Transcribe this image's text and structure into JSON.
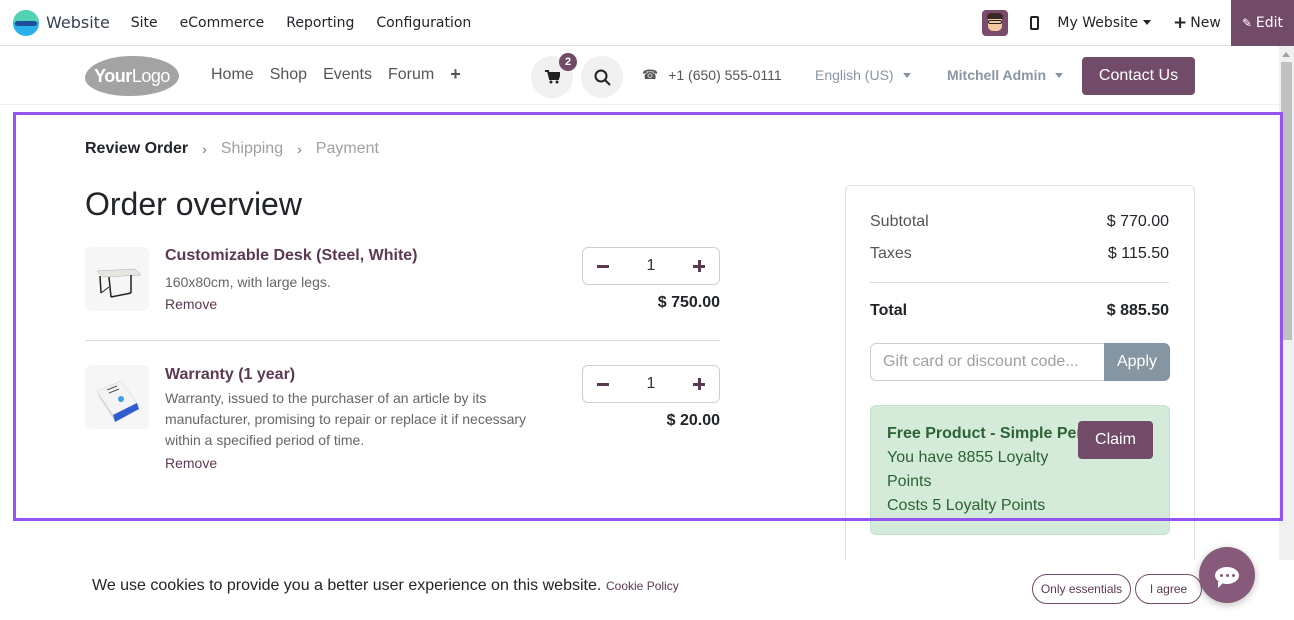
{
  "topbar": {
    "app_name": "Website",
    "menu": [
      "Site",
      "eCommerce",
      "Reporting",
      "Configuration"
    ],
    "website_selector": "My Website",
    "new_label": "New",
    "edit_label": "Edit"
  },
  "header": {
    "logo_bold": "Your",
    "logo_light": "Logo",
    "nav": [
      "Home",
      "Shop",
      "Events",
      "Forum"
    ],
    "add_icon": "+",
    "cart_count": "2",
    "phone": "+1 (650) 555-0111",
    "language": "English (US)",
    "user": "Mitchell Admin",
    "contact_label": "Contact Us"
  },
  "steps": {
    "active": "Review Order",
    "step2": "Shipping",
    "step3": "Payment"
  },
  "page_title": "Order overview",
  "items": [
    {
      "name": "Customizable Desk (Steel, White)",
      "description": "160x80cm, with large legs.",
      "remove_label": "Remove",
      "quantity": "1",
      "price": "$ 750.00"
    },
    {
      "name": "Warranty (1 year)",
      "description": "Warranty, issued to the purchaser of an article by its manufacturer, promising to repair or replace it if necessary within a specified period of time.",
      "remove_label": "Remove",
      "quantity": "1",
      "price": "$ 20.00"
    }
  ],
  "summary": {
    "subtotal_label": "Subtotal",
    "subtotal": "$ 770.00",
    "taxes_label": "Taxes",
    "taxes": "$ 115.50",
    "total_label": "Total",
    "total": "$ 885.50",
    "coupon_placeholder": "Gift card or discount code...",
    "apply_label": "Apply",
    "reward": {
      "title": "Free Product - Simple Pen",
      "line1": "You have 8855 Loyalty",
      "line2": "Points",
      "line3": "Costs 5 Loyalty Points",
      "claim_label": "Claim"
    }
  },
  "cookie": {
    "message": "We use cookies to provide you a better user experience on this website.",
    "policy_label": "Cookie Policy",
    "essentials_label": "Only essentials",
    "agree_label": "I agree"
  },
  "colors": {
    "brand": "#714b67",
    "highlight": "#9354f2",
    "reward_bg": "#d4ebd9"
  }
}
